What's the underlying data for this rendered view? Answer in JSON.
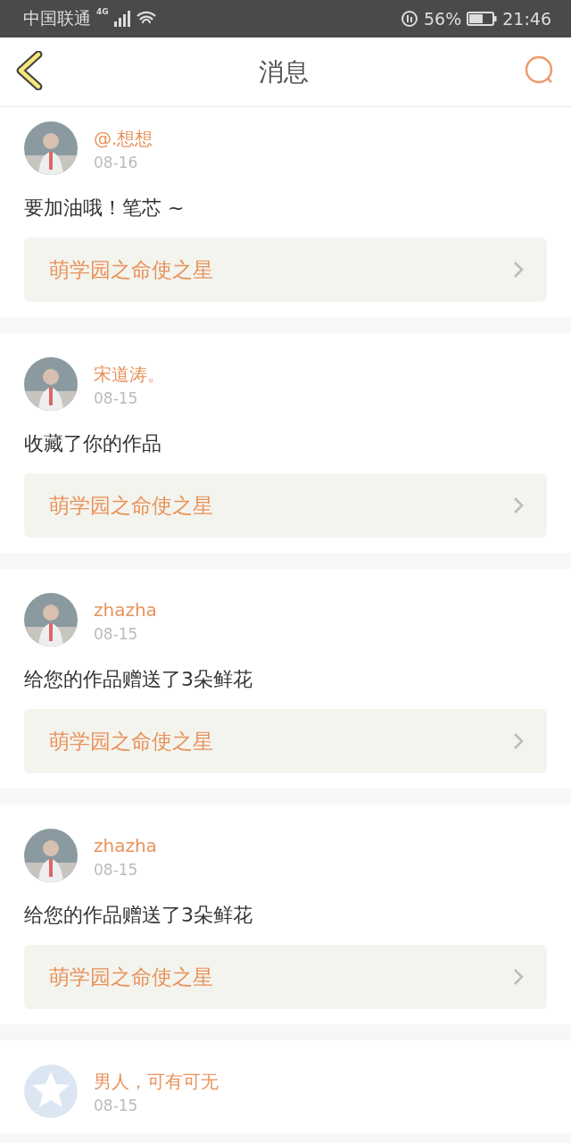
{
  "status_bar": {
    "carrier": "中国联通",
    "network": "4G",
    "battery": "56%",
    "time": "21:46"
  },
  "header": {
    "title": "消息"
  },
  "messages": [
    {
      "kind": "picture",
      "name": "@.想想",
      "date": "08-16",
      "text": "要加油哦！笔芯 ~",
      "work": "萌学园之命使之星"
    },
    {
      "kind": "picture",
      "name": "宋道涛。",
      "date": "08-15",
      "text": "收藏了你的作品",
      "work": "萌学园之命使之星"
    },
    {
      "kind": "picture",
      "name": "zhazha",
      "date": "08-15",
      "text": "给您的作品赠送了3朵鲜花",
      "work": "萌学园之命使之星"
    },
    {
      "kind": "picture",
      "name": "zhazha",
      "date": "08-15",
      "text": "给您的作品赠送了3朵鲜花",
      "work": "萌学园之命使之星"
    },
    {
      "kind": "default",
      "name": "男人，可有可无",
      "date": "08-15"
    }
  ]
}
